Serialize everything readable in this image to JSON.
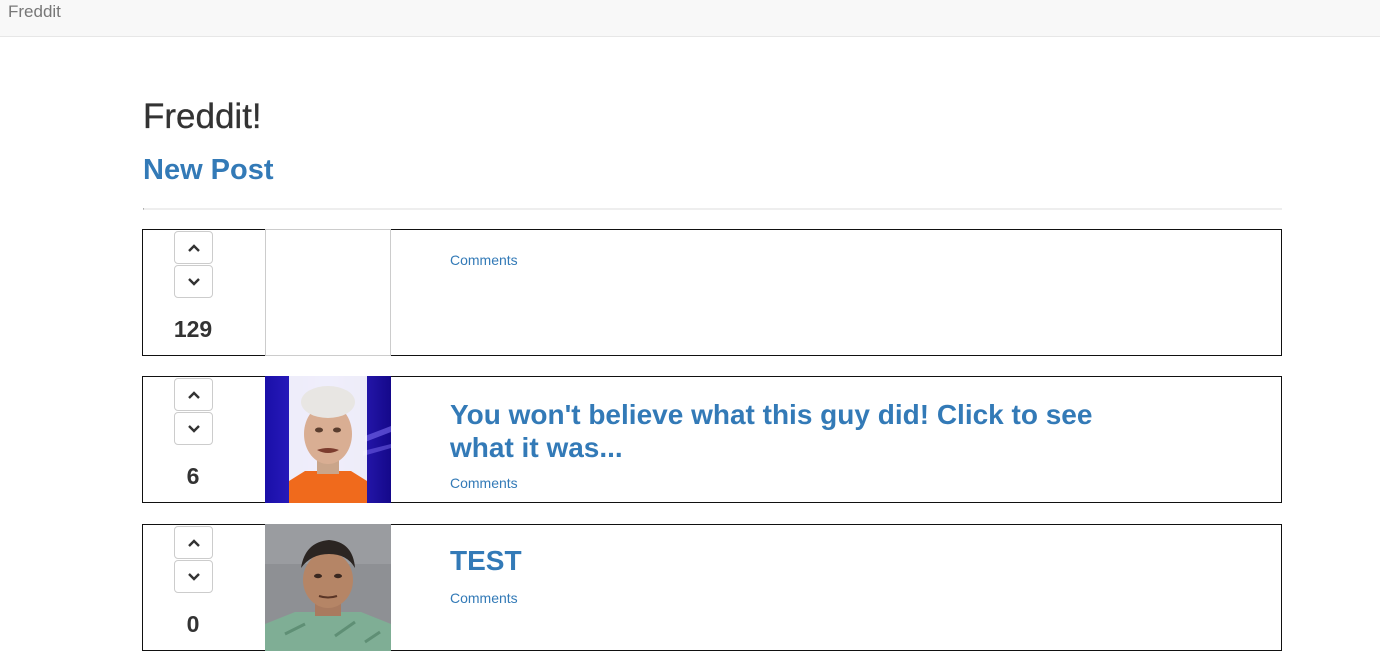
{
  "navbar": {
    "brand": "Freddit"
  },
  "page": {
    "title": "Freddit!",
    "new_post_label": "New Post"
  },
  "posts": [
    {
      "score": "129",
      "title": "",
      "comments_label": "Comments",
      "thumbnail": "empty"
    },
    {
      "score": "6",
      "title": "You won't believe what this guy did! Click to see what it was...",
      "comments_label": "Comments",
      "thumbnail": "mugshot-hairnet-photo"
    },
    {
      "score": "0",
      "title": "TEST",
      "comments_label": "Comments",
      "thumbnail": "mugshot-man-photo"
    }
  ],
  "icons": {
    "upvote": "chevron-up-icon",
    "downvote": "chevron-down-icon"
  },
  "colors": {
    "link": "#337ab7",
    "navbar_bg": "#f8f8f8",
    "post_border": "#111111"
  }
}
